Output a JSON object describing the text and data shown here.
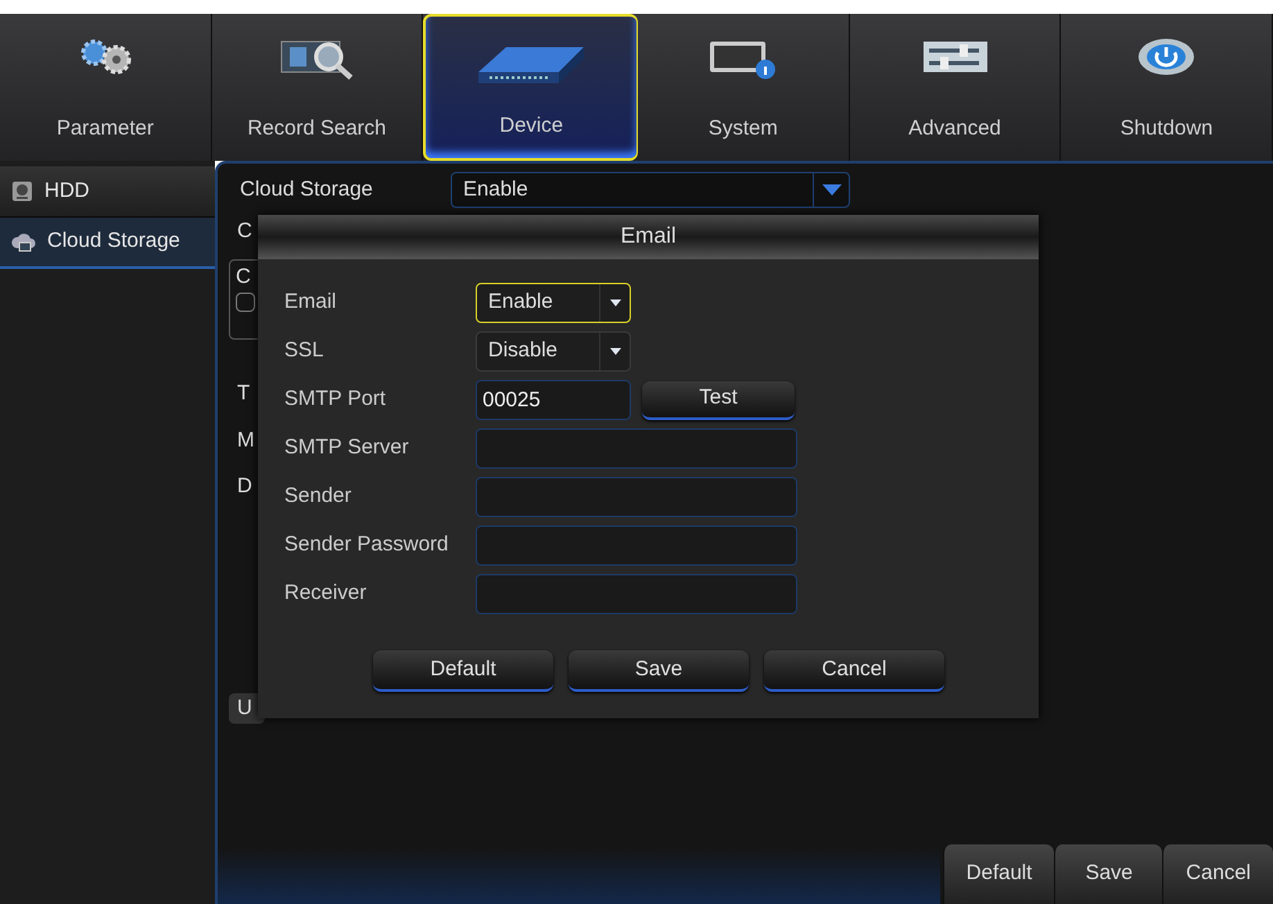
{
  "tabs": [
    {
      "label": "Parameter",
      "selected": false
    },
    {
      "label": "Record Search",
      "selected": false
    },
    {
      "label": "Device",
      "selected": true
    },
    {
      "label": "System",
      "selected": false
    },
    {
      "label": "Advanced",
      "selected": false
    },
    {
      "label": "Shutdown",
      "selected": false
    }
  ],
  "sidebar": {
    "items": [
      {
        "label": "HDD",
        "selected": false
      },
      {
        "label": "Cloud Storage",
        "selected": true
      }
    ]
  },
  "panel": {
    "cloud_storage": {
      "label": "Cloud Storage",
      "value": "Enable"
    },
    "partial_labels": [
      {
        "text": "C",
        "kind": "label"
      },
      {
        "text": "C",
        "kind": "group",
        "checked": false
      },
      {
        "text": "T",
        "kind": "label"
      },
      {
        "text": "M",
        "kind": "label"
      },
      {
        "text": "D",
        "kind": "label"
      },
      {
        "text": "U",
        "kind": "button"
      }
    ],
    "buttons": [
      "Default",
      "Save",
      "Cancel"
    ]
  },
  "dialog": {
    "title": "Email",
    "fields": [
      {
        "label": "Email",
        "kind": "select",
        "value": "Enable",
        "focused": true
      },
      {
        "label": "SSL",
        "kind": "select",
        "value": "Disable",
        "focused": false
      },
      {
        "label": "SMTP Port",
        "kind": "input",
        "value": "00025",
        "button": "Test"
      },
      {
        "label": "SMTP Server",
        "kind": "input"
      },
      {
        "label": "Sender",
        "kind": "input"
      },
      {
        "label": "Sender Password",
        "kind": "input"
      },
      {
        "label": "Receiver",
        "kind": "input"
      }
    ],
    "buttons": [
      "Default",
      "Save",
      "Cancel"
    ]
  }
}
